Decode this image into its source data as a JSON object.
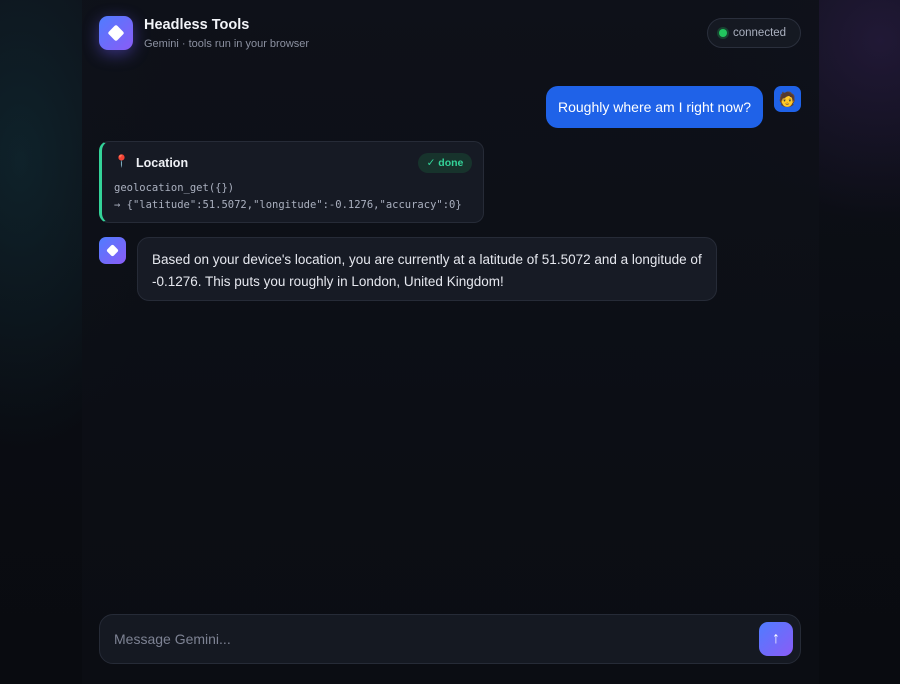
{
  "header": {
    "title": "Headless Tools",
    "subtitle": "Gemini · tools run in your browser",
    "status": "connected",
    "status_color": "#22c55e"
  },
  "messages": {
    "user": {
      "text": "Roughly where am I right now?",
      "avatar": "🧑"
    },
    "tool": {
      "icon": "📍",
      "name": "Location",
      "badge": "✓ done",
      "call": "geolocation_get({})",
      "result": "→ {\"latitude\":51.5072,\"longitude\":-0.1276,\"accuracy\":0}"
    },
    "assistant": {
      "text": "Based on your device's location, you are currently at a latitude of 51.5072 and a longitude of -0.1276. This puts you roughly in London, United Kingdom!"
    }
  },
  "composer": {
    "placeholder": "Message Gemini...",
    "value": "",
    "send_icon": "↑"
  },
  "colors": {
    "accent": "#1f62e8",
    "success": "#34d399"
  }
}
